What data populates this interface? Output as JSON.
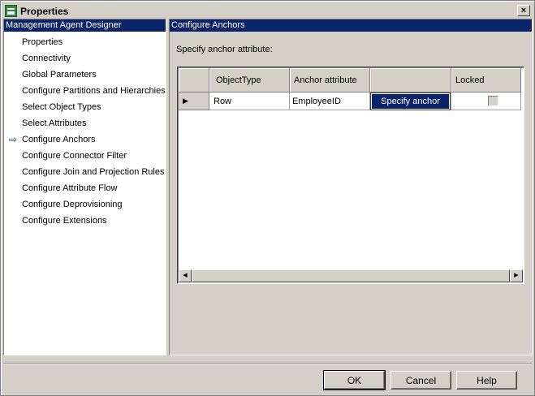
{
  "window": {
    "title": "Properties",
    "close_label": "×"
  },
  "sidebar": {
    "header": "Management Agent Designer",
    "items": [
      {
        "label": "Properties",
        "active": false
      },
      {
        "label": "Connectivity",
        "active": false
      },
      {
        "label": "Global Parameters",
        "active": false
      },
      {
        "label": "Configure Partitions and Hierarchies",
        "active": false
      },
      {
        "label": "Select Object Types",
        "active": false
      },
      {
        "label": "Select Attributes",
        "active": false
      },
      {
        "label": "Configure Anchors",
        "active": true
      },
      {
        "label": "Configure Connector Filter",
        "active": false
      },
      {
        "label": "Configure Join and Projection Rules",
        "active": false
      },
      {
        "label": "Configure Attribute Flow",
        "active": false
      },
      {
        "label": "Configure Deprovisioning",
        "active": false
      },
      {
        "label": "Configure Extensions",
        "active": false
      }
    ],
    "active_icon": "arrow-right-icon"
  },
  "main": {
    "header": "Configure Anchors",
    "instruction": "Specify anchor attribute:",
    "grid": {
      "columns": [
        "ObjectType",
        "Anchor attribute",
        "",
        "Locked"
      ],
      "rows": [
        {
          "object_type": "Row",
          "anchor_attribute": "EmployeeID",
          "action_label": "Specify anchor",
          "locked": false
        }
      ]
    }
  },
  "buttons": {
    "ok": "OK",
    "cancel": "Cancel",
    "help": "Help"
  }
}
